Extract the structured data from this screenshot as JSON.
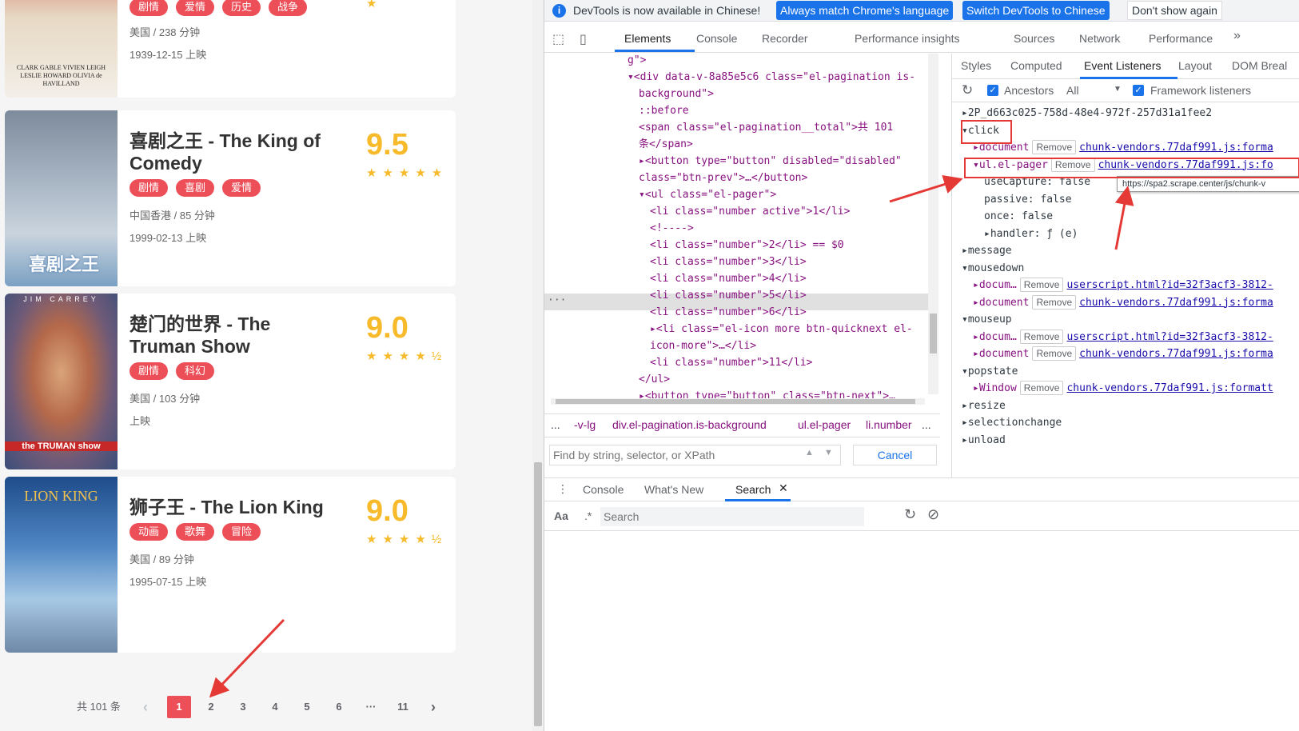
{
  "page": {
    "top_card": {
      "tags": [
        "剧情",
        "爱情",
        "历史",
        "战争"
      ],
      "meta": "美国 / 238 分钟",
      "date": "1939-12-15 上映",
      "poster_caption": "CLARK GABLE VIVIEN LEIGH LESLIE HOWARD OLIVIA de HAVILLAND"
    },
    "cards": [
      {
        "title": "喜剧之王 - The King of Comedy",
        "score": "9.5",
        "tags": [
          "剧情",
          "喜剧",
          "爱情"
        ],
        "meta": "中国香港 / 85 分钟",
        "date": "1999-02-13 上映",
        "poster_text": "喜剧之王",
        "stars": "★★★★★"
      },
      {
        "title": "楚门的世界 - The Truman Show",
        "score": "9.0",
        "tags": [
          "剧情",
          "科幻"
        ],
        "meta": "美国 / 103 分钟",
        "date": "上映",
        "poster_text": "the TRUMAN show",
        "poster_top": "JIM CARREY",
        "stars": "★★★★½"
      },
      {
        "title": "狮子王 - The Lion King",
        "score": "9.0",
        "tags": [
          "动画",
          "歌舞",
          "冒险"
        ],
        "meta": "美国 / 89 分钟",
        "date": "1995-07-15 上映",
        "poster_text": "LION KING",
        "stars": "★★★★½"
      }
    ],
    "pagination": {
      "total": "共 101 条",
      "pages": [
        "1",
        "2",
        "3",
        "4",
        "5",
        "6",
        "···",
        "11"
      ],
      "prev": "‹",
      "next": "›"
    }
  },
  "devtools": {
    "infobar": {
      "message": "DevTools is now available in Chinese!",
      "btn1": "Always match Chrome's language",
      "btn2": "Switch DevTools to Chinese",
      "btn3": "Don't show again"
    },
    "tabs": [
      "Elements",
      "Console",
      "Recorder",
      "Performance insights",
      "Sources",
      "Network",
      "Performance"
    ],
    "elements": [
      {
        "indent": 0,
        "html": "g\">"
      },
      {
        "indent": 0,
        "html": "▾<div data-v-8a85e5c6 class=\"el-pagination is-"
      },
      {
        "indent": 1,
        "html": "background\">"
      },
      {
        "indent": 1,
        "html": "::before"
      },
      {
        "indent": 1,
        "html": "<span class=\"el-pagination__total\">共 101"
      },
      {
        "indent": 1,
        "html": "条</span>"
      },
      {
        "indent": 1,
        "html": "▸<button type=\"button\" disabled=\"disabled\""
      },
      {
        "indent": 1,
        "html": "class=\"btn-prev\">…</button>"
      },
      {
        "indent": 1,
        "html": "▾<ul class=\"el-pager\">"
      },
      {
        "indent": 2,
        "html": "<li class=\"number active\">1</li>"
      },
      {
        "indent": 2,
        "html": "<!---->"
      },
      {
        "indent": 2,
        "html": "<li class=\"number\">2</li> == $0"
      },
      {
        "indent": 2,
        "html": "<li class=\"number\">3</li>"
      },
      {
        "indent": 2,
        "html": "<li class=\"number\">4</li>"
      },
      {
        "indent": 2,
        "html": "<li class=\"number\">5</li>"
      },
      {
        "indent": 2,
        "html": "<li class=\"number\">6</li>"
      },
      {
        "indent": 2,
        "html": "▸<li class=\"el-icon more btn-quicknext el-"
      },
      {
        "indent": 2,
        "html": "icon-more\">…</li>"
      },
      {
        "indent": 2,
        "html": "<li class=\"number\">11</li>"
      },
      {
        "indent": 1,
        "html": "</ul>"
      },
      {
        "indent": 1,
        "html": "▸<button type=\"button\" class=\"btn-next\">…"
      }
    ],
    "breadcrumb": [
      "...",
      "-v-lg",
      "div.el-pagination.is-background",
      "ul.el-pager",
      "li.number",
      "..."
    ],
    "find_placeholder": "Find by string, selector, or XPath",
    "cancel": "Cancel",
    "drawer_tabs": [
      "Console",
      "What's New",
      "Search"
    ],
    "search_placeholder": "Search",
    "search_aa": "Aa",
    "search_regex": ".*",
    "right_tabs": [
      "Styles",
      "Computed",
      "Event Listeners",
      "Layout",
      "DOM Breal"
    ],
    "ancestors": "Ancestors",
    "all": "All",
    "framework": "Framework listeners",
    "listeners": [
      {
        "text": "▸2P_d663c025-758d-48e4-972f-257d31a1fee2",
        "indent": 0
      },
      {
        "text": "▾click",
        "indent": 0
      },
      {
        "text": "▸document",
        "indent": 1,
        "remove": true,
        "link": "chunk-vendors.77daf991.js:forma"
      },
      {
        "text": "▾ul.el-pager",
        "indent": 1,
        "remove": true,
        "link": "chunk-vendors.77daf991.js:fo"
      },
      {
        "text": "useCapture: false",
        "indent": 2
      },
      {
        "text": "passive: false",
        "indent": 2
      },
      {
        "text": "once: false",
        "indent": 2
      },
      {
        "text": "▸handler: ƒ (e)",
        "indent": 2
      },
      {
        "text": "▸message",
        "indent": 0
      },
      {
        "text": "▾mousedown",
        "indent": 0
      },
      {
        "text": "▸docum…",
        "indent": 1,
        "remove": true,
        "link": "userscript.html?id=32f3acf3-3812-"
      },
      {
        "text": "▸document",
        "indent": 1,
        "remove": true,
        "link": "chunk-vendors.77daf991.js:forma"
      },
      {
        "text": "▾mouseup",
        "indent": 0
      },
      {
        "text": "▸docum…",
        "indent": 1,
        "remove": true,
        "link": "userscript.html?id=32f3acf3-3812-"
      },
      {
        "text": "▸document",
        "indent": 1,
        "remove": true,
        "link": "chunk-vendors.77daf991.js:forma"
      },
      {
        "text": "▾popstate",
        "indent": 0
      },
      {
        "text": "▸Window",
        "indent": 1,
        "remove": true,
        "link": "chunk-vendors.77daf991.js:formatt"
      },
      {
        "text": "▸resize",
        "indent": 0
      },
      {
        "text": "▸selectionchange",
        "indent": 0
      },
      {
        "text": "▸unload",
        "indent": 0
      }
    ],
    "remove_label": "Remove",
    "tooltip": "https://spa2.scrape.center/js/chunk-v"
  }
}
